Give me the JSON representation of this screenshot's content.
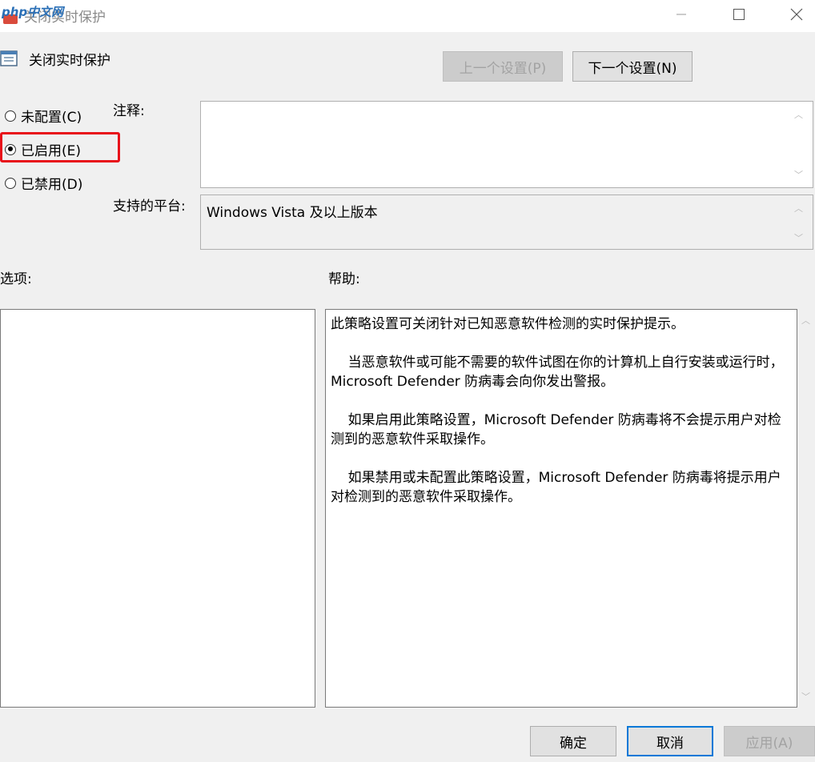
{
  "window": {
    "title": "关闭实时保护",
    "watermark": "php中文网"
  },
  "policy": {
    "name": "关闭实时保护",
    "prev_label": "上一个设置(P)",
    "next_label": "下一个设置(N)"
  },
  "state_options": [
    {
      "label": "未配置(C)",
      "checked": false
    },
    {
      "label": "已启用(E)",
      "checked": true
    },
    {
      "label": "已禁用(D)",
      "checked": false
    }
  ],
  "comment": {
    "label": "注释:",
    "value": ""
  },
  "platform": {
    "label": "支持的平台:",
    "value": "Windows Vista 及以上版本"
  },
  "options": {
    "label": "选项:"
  },
  "help": {
    "label": "帮助:",
    "paragraphs": [
      "此策略设置可关闭针对已知恶意软件检测的实时保护提示。",
      "    当恶意软件或可能不需要的软件试图在你的计算机上自行安装或运行时，Microsoft Defender 防病毒会向你发出警报。",
      "    如果启用此策略设置，Microsoft Defender 防病毒将不会提示用户对检测到的恶意软件采取操作。",
      "    如果禁用或未配置此策略设置，Microsoft Defender 防病毒将提示用户对检测到的恶意软件采取操作。"
    ]
  },
  "footer": {
    "ok_label": "确定",
    "cancel_label": "取消",
    "apply_label": "应用(A)"
  },
  "colors": {
    "highlight": "#e8101a",
    "accent": "#0078d7"
  }
}
